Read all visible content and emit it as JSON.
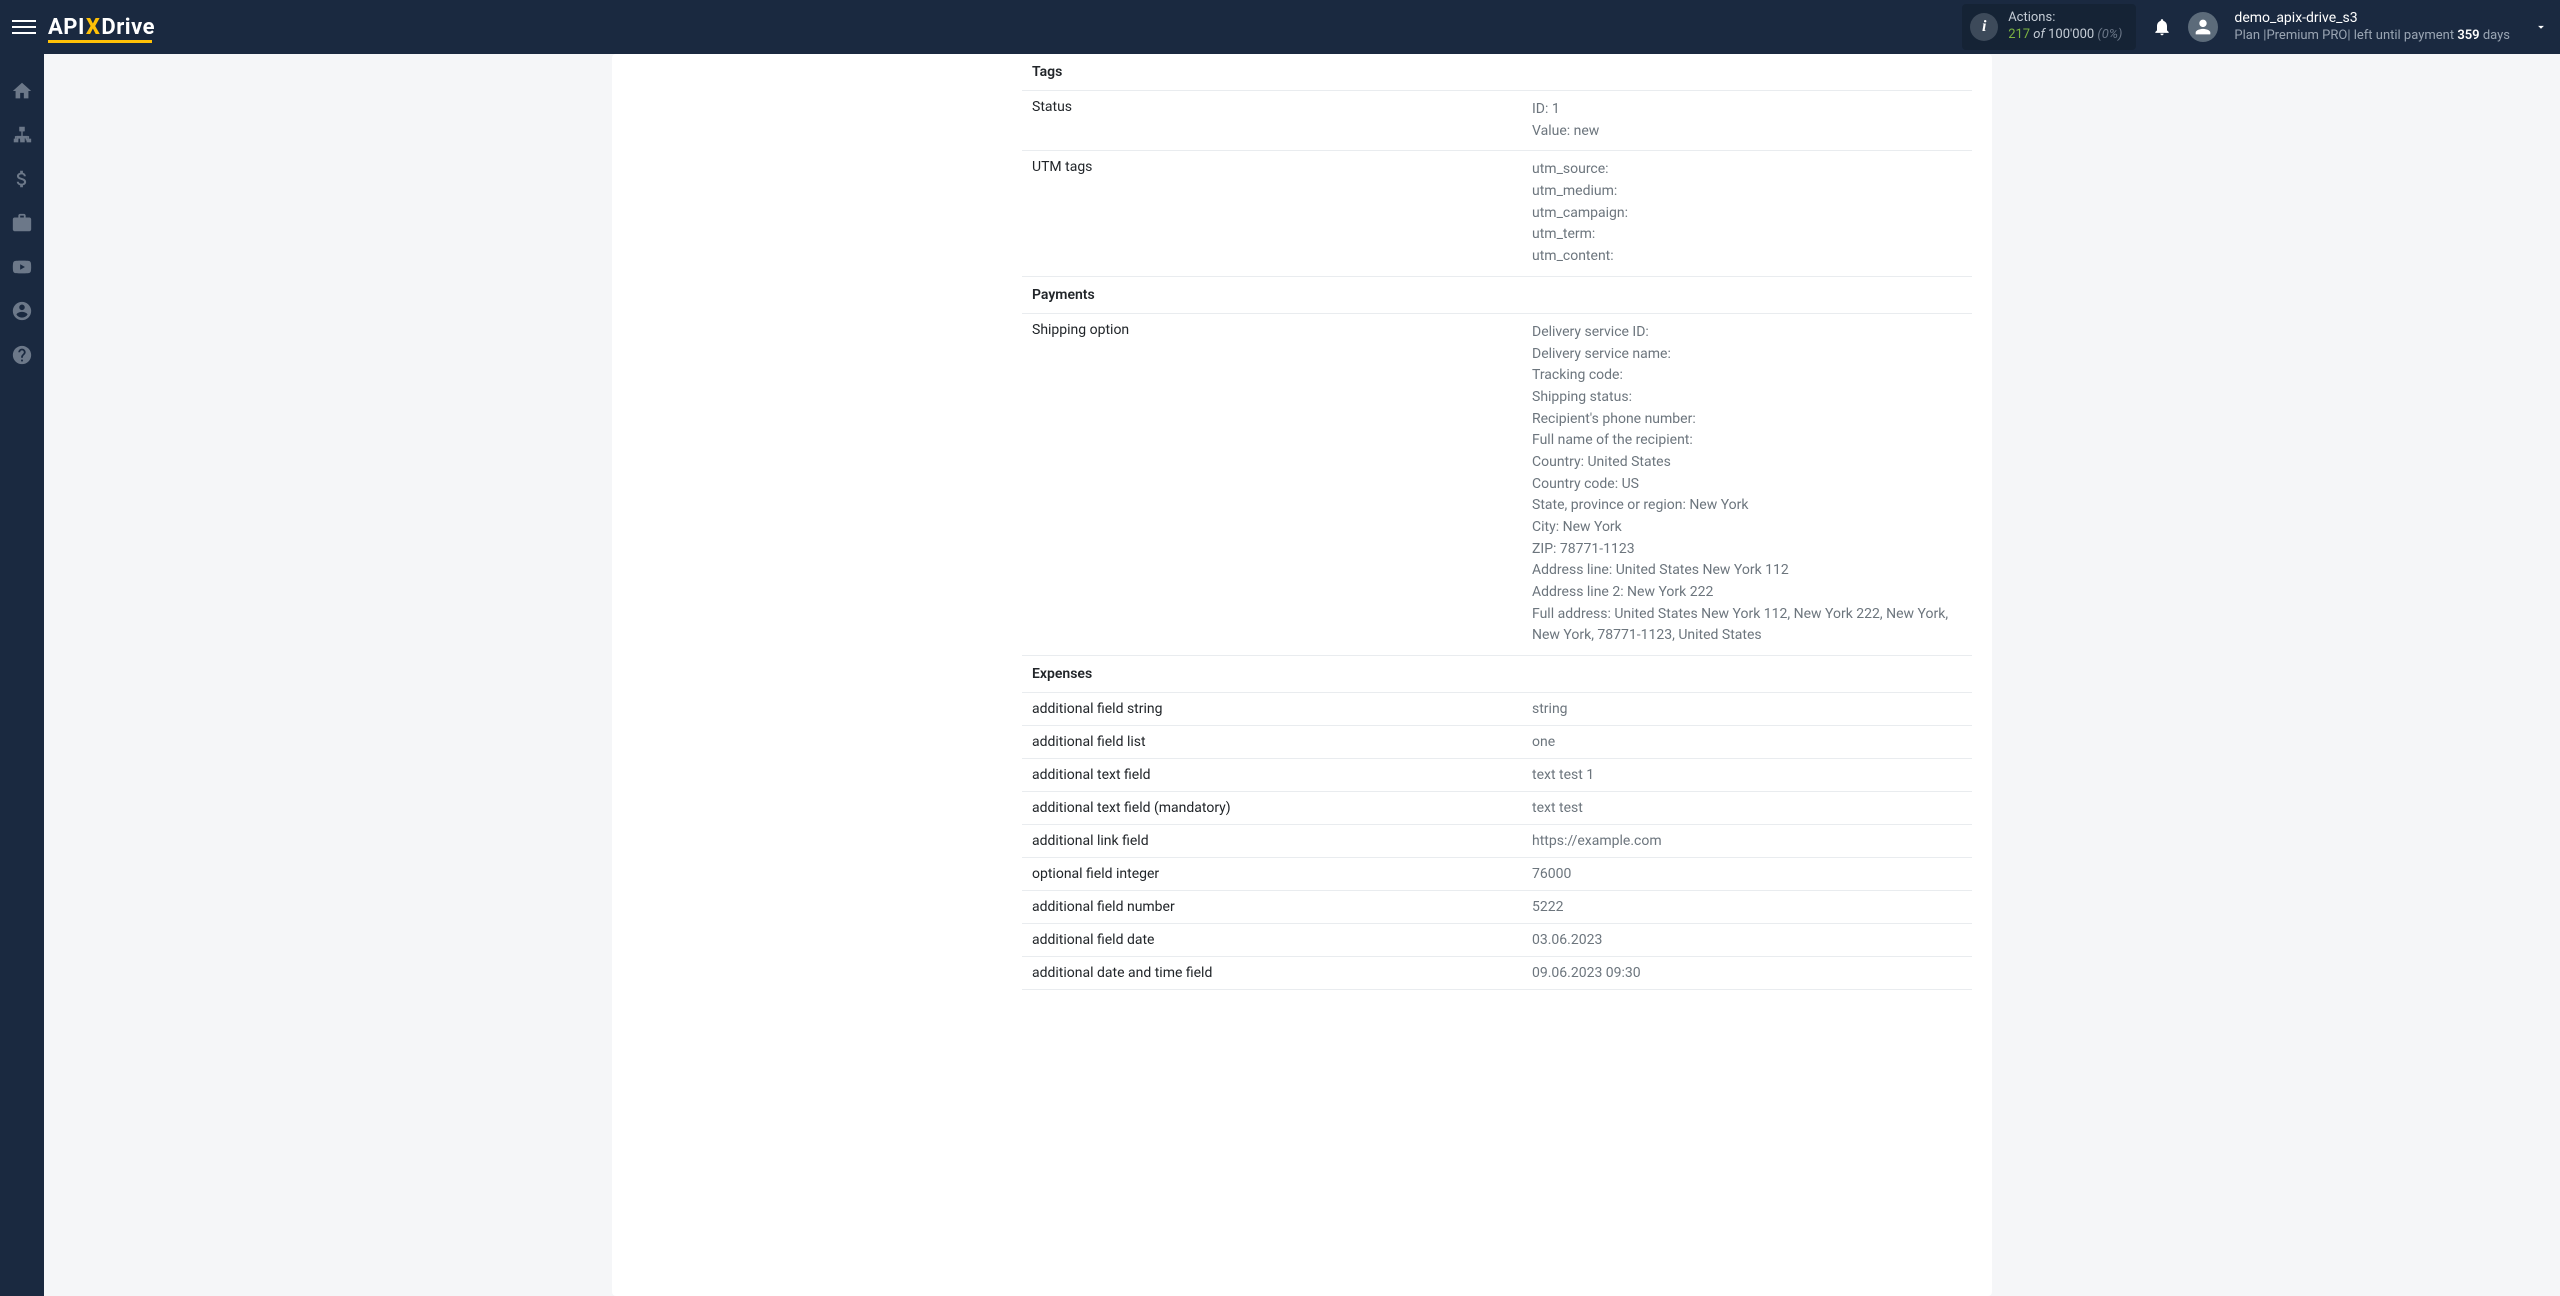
{
  "header": {
    "actions": {
      "label": "Actions:",
      "count": "217",
      "of": " of ",
      "total": "100'000",
      "pct": " (0%)"
    },
    "user": {
      "name": "demo_apix-drive_s3",
      "plan_prefix": "Plan |",
      "plan_name": "Premium PRO",
      "plan_mid": "| left until payment ",
      "days": "359",
      "days_suffix": " days"
    }
  },
  "rows": {
    "tags_header": "Tags",
    "status_label": "Status",
    "status_v1": "ID: 1",
    "status_v2": "Value: new",
    "utm_label": "UTM tags",
    "utm_v1": "utm_source:",
    "utm_v2": "utm_medium:",
    "utm_v3": "utm_campaign:",
    "utm_v4": "utm_term:",
    "utm_v5": "utm_content:",
    "payments_header": "Payments",
    "shipping_label": "Shipping option",
    "ship_v1": "Delivery service ID:",
    "ship_v2": "Delivery service name:",
    "ship_v3": "Tracking code:",
    "ship_v4": "Shipping status:",
    "ship_v5": "Recipient's phone number:",
    "ship_v6": "Full name of the recipient:",
    "ship_v7": "Country: United States",
    "ship_v8": "Country code: US",
    "ship_v9": "State, province or region: New York",
    "ship_v10": "City: New York",
    "ship_v11": "ZIP: 78771-1123",
    "ship_v12": "Address line: United States New York 112",
    "ship_v13": "Address line 2: New York 222",
    "ship_v14": "Full address: United States New York 112, New York 222, New York, New York, 78771-1123, United States",
    "expenses_header": "Expenses",
    "af_string_label": "additional field string",
    "af_string_value": "string",
    "af_list_label": "additional field list",
    "af_list_value": "one",
    "af_text_label": "additional text field",
    "af_text_value": "text test 1",
    "af_text_m_label": "additional text field (mandatory)",
    "af_text_m_value": "text test",
    "af_link_label": "additional link field",
    "af_link_value": "https://example.com",
    "af_int_label": "optional field integer",
    "af_int_value": "76000",
    "af_num_label": "additional field number",
    "af_num_value": "5222",
    "af_date_label": "additional field date",
    "af_date_value": "03.06.2023",
    "af_dt_label": "additional date and time field",
    "af_dt_value": "09.06.2023 09:30"
  }
}
